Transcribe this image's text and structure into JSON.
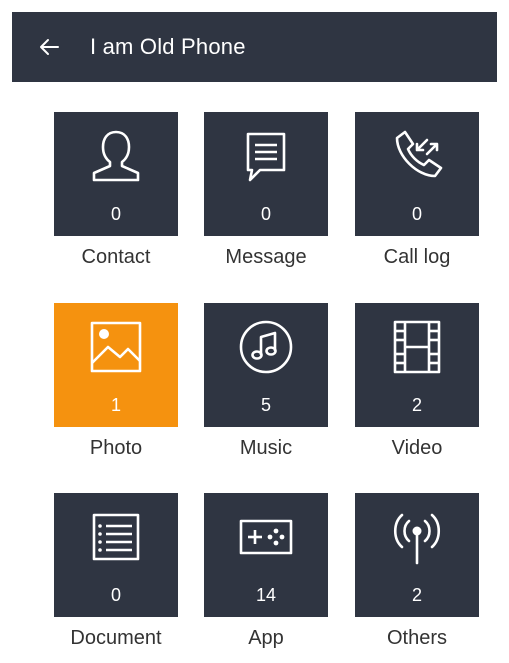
{
  "header": {
    "title": "I am Old Phone",
    "back_icon": "arrow-left-icon",
    "background": "#2f3542"
  },
  "colors": {
    "tile": "#2f3542",
    "tile_active": "#f5920f",
    "label": "#333333"
  },
  "categories": [
    {
      "label": "Contact",
      "count": "0",
      "icon": "person-icon",
      "active": false
    },
    {
      "label": "Message",
      "count": "0",
      "icon": "message-icon",
      "active": false
    },
    {
      "label": "Call log",
      "count": "0",
      "icon": "phone-call-icon",
      "active": false
    },
    {
      "label": "Photo",
      "count": "1",
      "icon": "image-icon",
      "active": true
    },
    {
      "label": "Music",
      "count": "5",
      "icon": "music-icon",
      "active": false
    },
    {
      "label": "Video",
      "count": "2",
      "icon": "film-icon",
      "active": false
    },
    {
      "label": "Document",
      "count": "0",
      "icon": "document-list-icon",
      "active": false
    },
    {
      "label": "App",
      "count": "14",
      "icon": "gamepad-icon",
      "active": false
    },
    {
      "label": "Others",
      "count": "2",
      "icon": "antenna-icon",
      "active": false
    }
  ]
}
